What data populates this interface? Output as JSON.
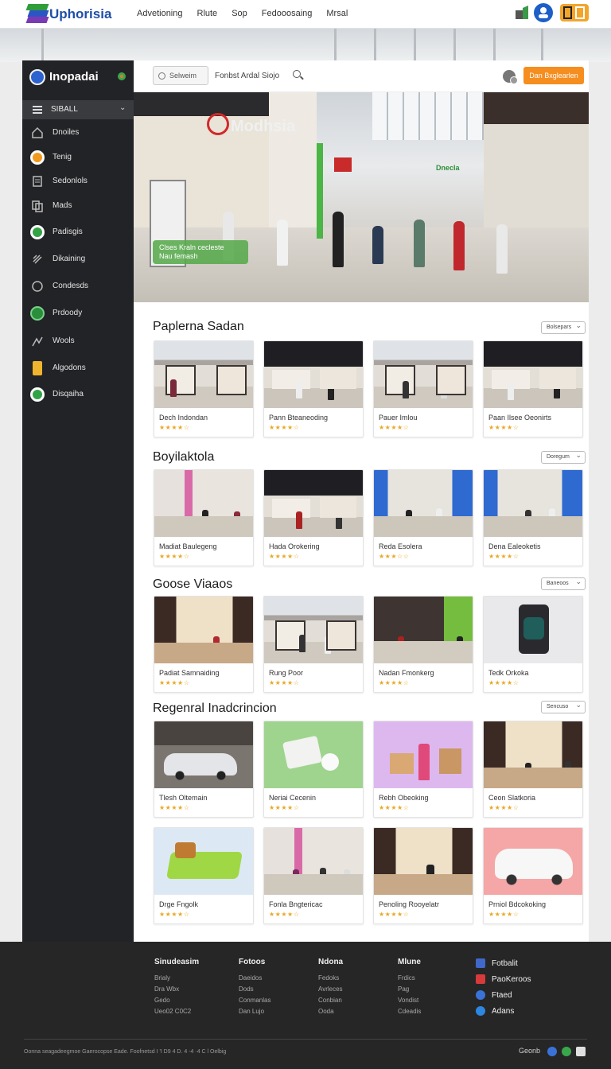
{
  "topbar": {
    "brand": "Uphorisia",
    "nav": [
      "Advetioning",
      "Rlute",
      "Sop",
      "Fedooosaing",
      "Mrsal"
    ]
  },
  "sidebar": {
    "brand": "Inopadai",
    "menu_label": "SIBALL",
    "items": [
      {
        "label": "Dnoiles",
        "icon": "home-icon"
      },
      {
        "label": "Tenig",
        "icon": "compass-icon"
      },
      {
        "label": "Sedonlols",
        "icon": "document-icon"
      },
      {
        "label": "Mads",
        "icon": "copy-icon"
      },
      {
        "label": "Padisgis",
        "icon": "globe-icon"
      },
      {
        "label": "Dikaining",
        "icon": "puzzle-icon"
      },
      {
        "label": "Condesds",
        "icon": "chat-icon"
      },
      {
        "label": "Prdoody",
        "icon": "leaf-icon"
      },
      {
        "label": "Wools",
        "icon": "chart-icon"
      },
      {
        "label": "Algodons",
        "icon": "battery-icon"
      },
      {
        "label": "Disqaiha",
        "icon": "planet-icon"
      }
    ]
  },
  "search": {
    "placeholder": "Selweim",
    "hint": "Fonbst Ardal Siojo",
    "cta": "Dan Bxglearlen"
  },
  "hero": {
    "sign": "Modhsia",
    "green_sign": "Dnecla",
    "caption_line1": "Clses Kraln cecleste",
    "caption_line2": "Nau femash"
  },
  "sections": [
    {
      "title": "Paplerna Sadan",
      "sort": "Bolsepars",
      "cards": [
        {
          "name": "Dech Indondan",
          "stars": "★★★★☆"
        },
        {
          "name": "Pann Bteaneoding",
          "stars": "★★★★☆"
        },
        {
          "name": "Pauer Imlou",
          "stars": "★★★★☆"
        },
        {
          "name": "Paan Ilsee Oeonirts",
          "stars": "★★★★☆"
        }
      ]
    },
    {
      "title": "Boyilaktola",
      "sort": "Doregum",
      "cards": [
        {
          "name": "Madiat Baulegeng",
          "stars": "★★★★☆"
        },
        {
          "name": "Hada Orokering",
          "stars": "★★★★☆"
        },
        {
          "name": "Reda Esolera",
          "stars": "★★★☆☆"
        },
        {
          "name": "Dena Ealeoketis",
          "stars": "★★★★☆"
        }
      ]
    },
    {
      "title": "Goose Viaaos",
      "sort": "Baneoos",
      "cards": [
        {
          "name": "Padiat Samnaiding",
          "stars": "★★★★☆"
        },
        {
          "name": "Rung Poor",
          "stars": "★★★★☆"
        },
        {
          "name": "Nadan Fmonkerg",
          "stars": "★★★★☆"
        },
        {
          "name": "Tedk Orkoka",
          "stars": "★★★★☆"
        }
      ]
    },
    {
      "title": "Regenral Inadcrincion",
      "sort": "Sencuso",
      "cards": [
        {
          "name": "Tlesh Oltemain",
          "stars": "★★★★☆"
        },
        {
          "name": "Neriai Cecenin",
          "stars": "★★★★☆"
        },
        {
          "name": "Rebh Obeoking",
          "stars": "★★★★☆"
        },
        {
          "name": "Ceon Slatkoria",
          "stars": "★★★★☆"
        },
        {
          "name": "Drge Fngolk",
          "stars": "★★★★☆"
        },
        {
          "name": "Fonla Bngtericac",
          "stars": "★★★★☆"
        },
        {
          "name": "Penoling Rooyelatr",
          "stars": "★★★★☆"
        },
        {
          "name": "Prniol Bdcokoking",
          "stars": "★★★★☆"
        }
      ]
    }
  ],
  "footer": {
    "columns": [
      {
        "heading": "Sinudeasim",
        "items": [
          "Brialy",
          "Dra Wbx",
          "Gedo",
          "Ueo02 C0C2"
        ]
      },
      {
        "heading": "Fotoos",
        "items": [
          "Daeidos",
          "Dods",
          "Conmanlas",
          "Dan Lujo"
        ]
      },
      {
        "heading": "Ndona",
        "items": [
          "Fedoks",
          "Avrleces",
          "Conbian",
          "Ooda"
        ]
      },
      {
        "heading": "Mlune",
        "items": [
          "Frdics",
          "Pag",
          "Vondist",
          "Cdeadis"
        ]
      }
    ],
    "social": [
      {
        "label": "Fotbalit",
        "color": "#3f68c8"
      },
      {
        "label": "PaoKeroos",
        "color": "#d63a3a"
      },
      {
        "label": "Ftaed",
        "color": "#3a73d8"
      },
      {
        "label": "Adans",
        "color": "#2d86e0"
      }
    ],
    "copyright": "Oonna seagadeegmoe Gaerocopse Eade. Foofnetsd  I  'I D9 4 D.  4 -4 ·4 C l Oelbig",
    "brand": "Geonb"
  },
  "colors": {
    "accent": "#f58d1f",
    "brand_blue": "#1f4ea8",
    "sidebar_bg": "#222326",
    "footer_bg": "#262626",
    "star": "#e9a825"
  }
}
